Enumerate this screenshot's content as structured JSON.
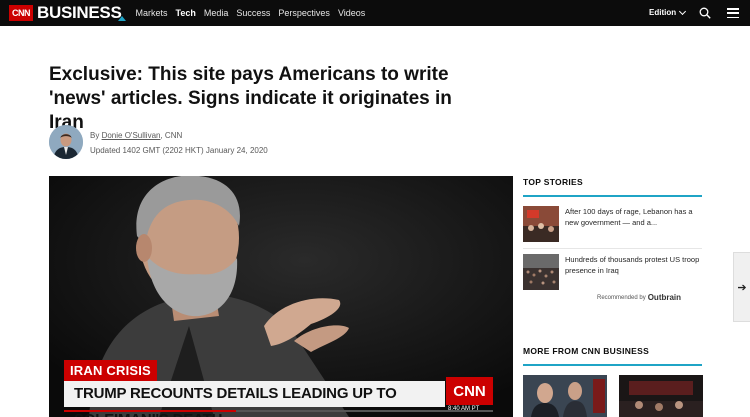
{
  "header": {
    "logo_cnn": "CNN",
    "logo_business": "BUSINESS",
    "nav": [
      "Markets",
      "Tech",
      "Media",
      "Success",
      "Perspectives",
      "Videos"
    ],
    "active_nav": "Tech",
    "edition_label": "Edition"
  },
  "article": {
    "headline": "Exclusive: This site pays Americans to write 'news' articles. Signs indicate it originates in Iran",
    "byline_prefix": "By",
    "author": "Donie O'Sullivan",
    "outlet": ", CNN",
    "updated": "Updated 1402 GMT (2202 HKT) January 24, 2020"
  },
  "video": {
    "tag": "IRAN CRISIS",
    "chyron": "TRUMP RECOUNTS DETAILS LEADING UP TO SOLEIMANI'S DEATH",
    "network_bug": "CNN",
    "time": "8:40 AM PT",
    "progress": 0.4
  },
  "sidebar": {
    "top_stories_title": "TOP STORIES",
    "stories": [
      {
        "text": "After 100 days of rage, Lebanon has a new government — and a..."
      },
      {
        "text": "Hundreds of thousands protest US troop presence in Iraq"
      }
    ],
    "recommended_prefix": "Recommended by",
    "recommended_brand": "Outbrain",
    "more_title": "MORE FROM CNN BUSINESS"
  },
  "colors": {
    "accent": "#1fa4c6",
    "brand_red": "#cc0000",
    "topbar": "#0c0c0c"
  },
  "icons": [
    "search-icon",
    "menu-icon",
    "chevron-down-icon",
    "arrow-right-icon"
  ]
}
